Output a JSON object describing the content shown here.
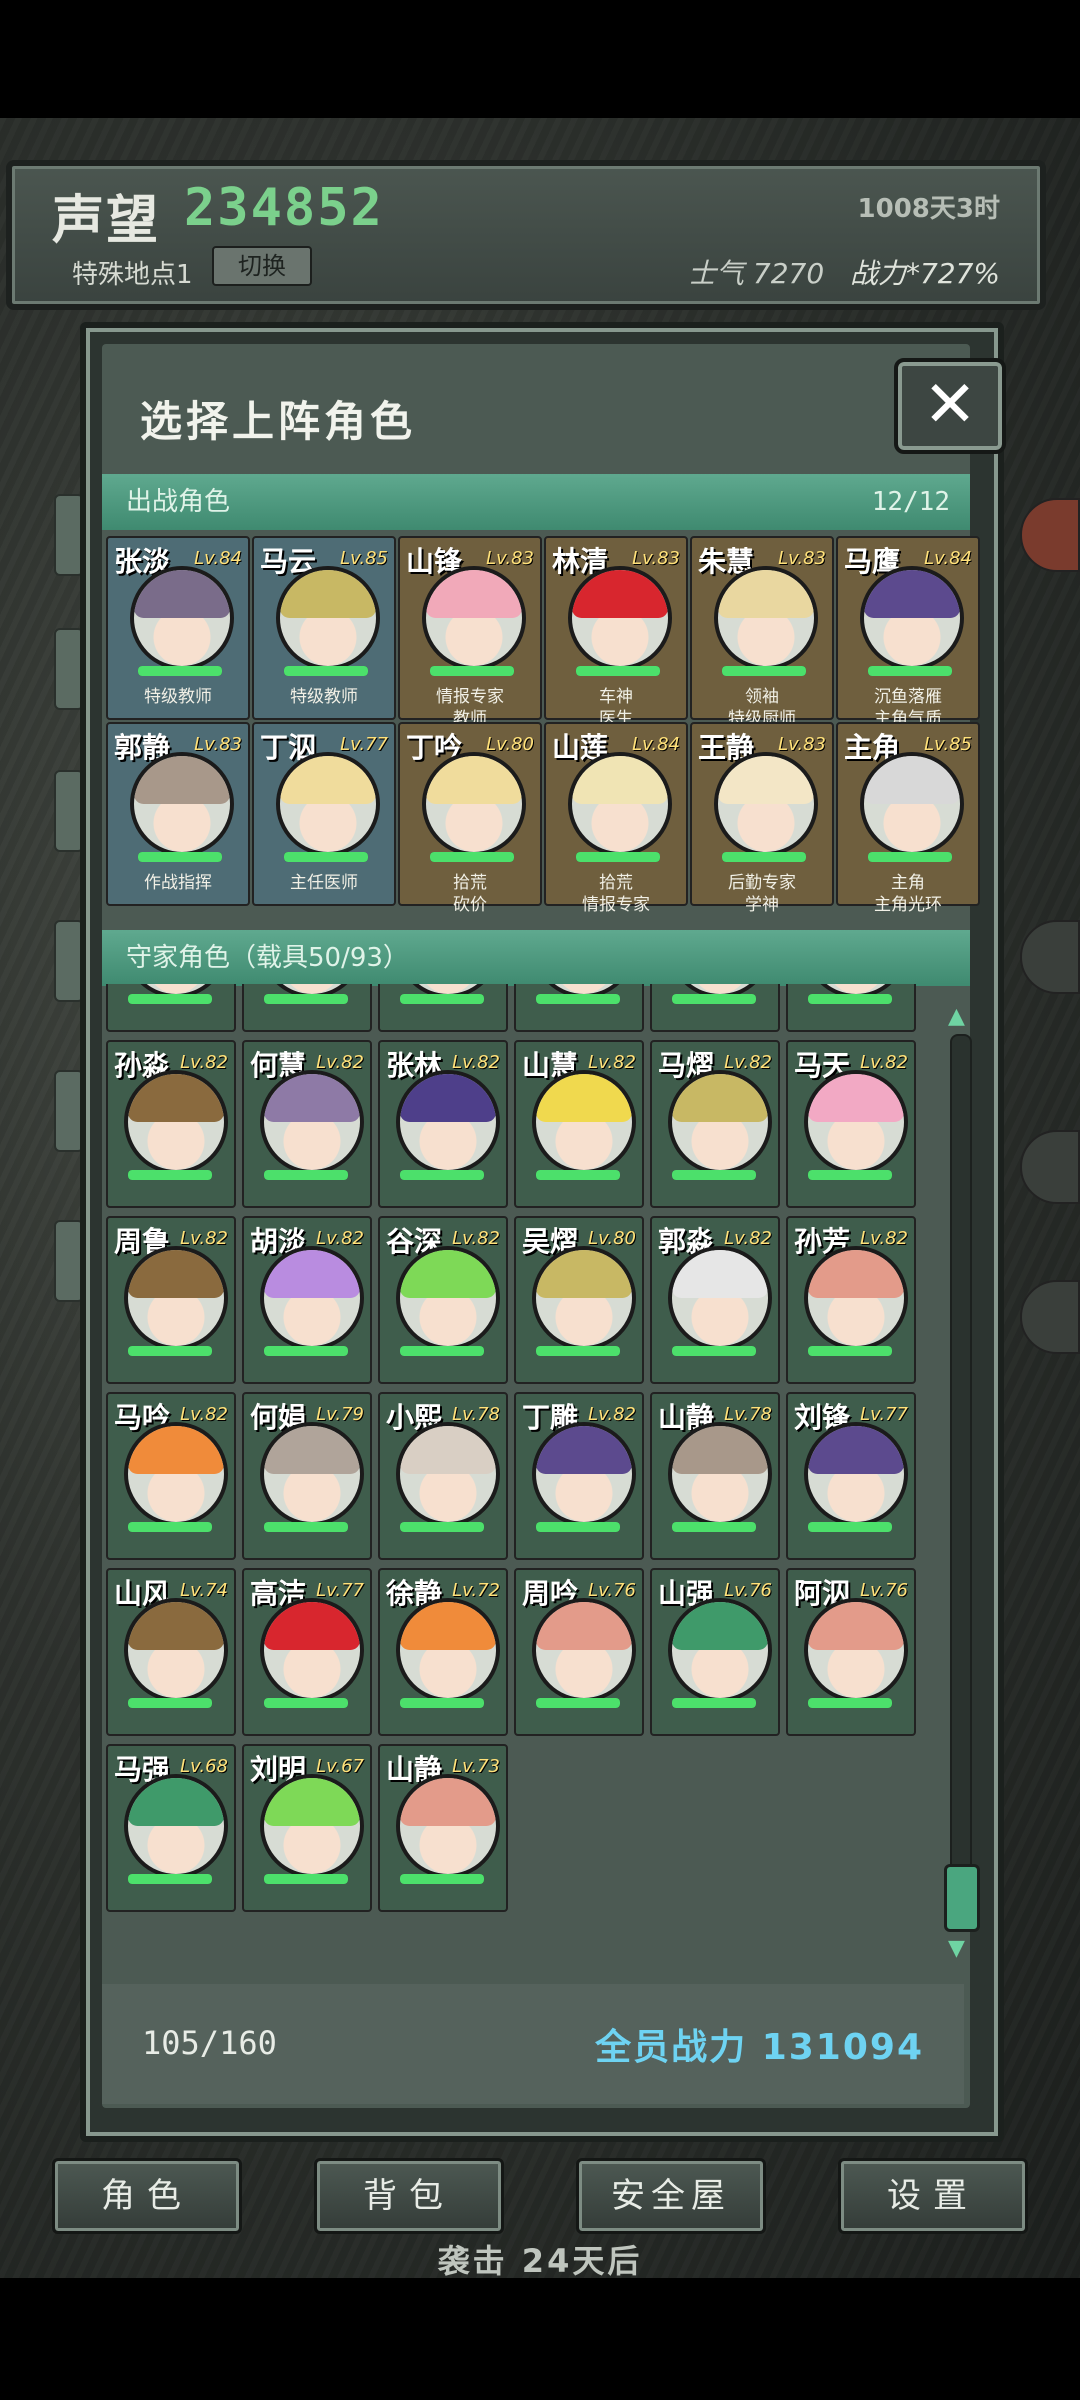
{
  "header": {
    "reputation_label": "声望",
    "reputation_value": "234852",
    "days": "1008天3时",
    "location_label": "特殊地点1",
    "switch_label": "切换",
    "morale": "士气 7270",
    "power": "战力*727%"
  },
  "modal": {
    "title": "选择上阵角色",
    "close_label": "✕",
    "deployed_header": "出战角色",
    "deployed_count": "12/12",
    "home_header": "守家角色（载具50/93）",
    "roster_count": "105/160",
    "total_power_label": "全员战力",
    "total_power_value": "131094"
  },
  "deployed": [
    {
      "name": "张淡",
      "level": "Lv.84",
      "role1": "特级教师",
      "role2": "",
      "tone": "blue",
      "hair": "#7a6c8a"
    },
    {
      "name": "马云",
      "level": "Lv.85",
      "role1": "特级教师",
      "role2": "",
      "tone": "blue",
      "hair": "#c8b864"
    },
    {
      "name": "山锋",
      "level": "Lv.83",
      "role1": "情报专家",
      "role2": "教师",
      "tone": "brown",
      "hair": "#f1a9b9"
    },
    {
      "name": "林清",
      "level": "Lv.83",
      "role1": "车神",
      "role2": "医生",
      "tone": "brown",
      "hair": "#d8262e"
    },
    {
      "name": "朱慧",
      "level": "Lv.83",
      "role1": "领袖",
      "role2": "特级厨师",
      "tone": "brown",
      "hair": "#e9d7a0"
    },
    {
      "name": "马鹰",
      "level": "Lv.84",
      "role1": "沉鱼落雁",
      "role2": "主角气质",
      "tone": "brown",
      "hair": "#5c4a8e"
    },
    {
      "name": "郭静",
      "level": "Lv.83",
      "role1": "作战指挥",
      "role2": "",
      "tone": "blue",
      "hair": "#a8988a"
    },
    {
      "name": "丁泅",
      "level": "Lv.77",
      "role1": "主任医师",
      "role2": "",
      "tone": "blue",
      "hair": "#f0dc9c"
    },
    {
      "name": "丁吟",
      "level": "Lv.80",
      "role1": "拾荒",
      "role2": "砍价",
      "tone": "brown",
      "hair": "#f0dc9c"
    },
    {
      "name": "山莲",
      "level": "Lv.84",
      "role1": "拾荒",
      "role2": "情报专家",
      "tone": "brown",
      "hair": "#f0e4b4"
    },
    {
      "name": "王静",
      "level": "Lv.83",
      "role1": "后勤专家",
      "role2": "学神",
      "tone": "brown",
      "hair": "#f3e6c6"
    },
    {
      "name": "主角",
      "level": "Lv.85",
      "role1": "主角",
      "role2": "主角光环",
      "tone": "brown",
      "hair": "#d8d8d8"
    }
  ],
  "home": [
    {
      "name": "",
      "level": "",
      "hair": "#6b5a4a"
    },
    {
      "name": "",
      "level": "",
      "hair": "#6b5a4a"
    },
    {
      "name": "",
      "level": "",
      "hair": "#6b5a4a"
    },
    {
      "name": "",
      "level": "",
      "hair": "#e8d6a4"
    },
    {
      "name": "",
      "level": "",
      "hair": "#e8d6a4"
    },
    {
      "name": "",
      "level": "",
      "hair": "#e8d6a4"
    },
    {
      "name": "孙淼",
      "level": "Lv.82",
      "hair": "#8a6a3e"
    },
    {
      "name": "何慧",
      "level": "Lv.82",
      "hair": "#8e7aa6"
    },
    {
      "name": "张林",
      "level": "Lv.82",
      "hair": "#4e3f8a"
    },
    {
      "name": "山慧",
      "level": "Lv.82",
      "hair": "#f0d94e"
    },
    {
      "name": "马熠",
      "level": "Lv.82",
      "hair": "#c8b864"
    },
    {
      "name": "马天",
      "level": "Lv.82",
      "hair": "#f2a9c4"
    },
    {
      "name": "周鲁",
      "level": "Lv.82",
      "hair": "#8a6a3e"
    },
    {
      "name": "胡淡",
      "level": "Lv.82",
      "hair": "#b98ce0"
    },
    {
      "name": "谷深",
      "level": "Lv.82",
      "hair": "#7ed957"
    },
    {
      "name": "吴熠",
      "level": "Lv.80",
      "hair": "#c8b864"
    },
    {
      "name": "郭淼",
      "level": "Lv.82",
      "hair": "#e6e6e6"
    },
    {
      "name": "孙芳",
      "level": "Lv.82",
      "hair": "#e39b8a"
    },
    {
      "name": "马吟",
      "level": "Lv.82",
      "hair": "#f08b3a"
    },
    {
      "name": "何娟",
      "level": "Lv.79",
      "hair": "#b0a49a"
    },
    {
      "name": "小熙",
      "level": "Lv.78",
      "hair": "#d9cfc4"
    },
    {
      "name": "丁雕",
      "level": "Lv.82",
      "hair": "#5c4a8e"
    },
    {
      "name": "山静",
      "level": "Lv.78",
      "hair": "#a8988a"
    },
    {
      "name": "刘锋",
      "level": "Lv.77",
      "hair": "#5c4a8e"
    },
    {
      "name": "山风",
      "level": "Lv.74",
      "hair": "#8a6a3e"
    },
    {
      "name": "高洁",
      "level": "Lv.77",
      "hair": "#d8262e"
    },
    {
      "name": "徐静",
      "level": "Lv.72",
      "hair": "#f08b3a"
    },
    {
      "name": "周吟",
      "level": "Lv.76",
      "hair": "#e39b8a"
    },
    {
      "name": "山强",
      "level": "Lv.76",
      "hair": "#3f9a6a"
    },
    {
      "name": "阿泅",
      "level": "Lv.76",
      "hair": "#e39b8a"
    },
    {
      "name": "马强",
      "level": "Lv.68",
      "hair": "#3f9a6a"
    },
    {
      "name": "刘明",
      "level": "Lv.67",
      "hair": "#7ed957"
    },
    {
      "name": "山静",
      "level": "Lv.73",
      "hair": "#e39b8a"
    }
  ],
  "nav": [
    {
      "label": "角色"
    },
    {
      "label": "背包"
    },
    {
      "label": "安全屋"
    },
    {
      "label": "设置"
    }
  ],
  "raid_text": "袭击 24天后",
  "side_marks": [
    "8",
    "5",
    "8",
    "4",
    "8",
    "8",
    "5",
    "8",
    "8",
    "5"
  ],
  "colors": {
    "accent": "#5fa98f",
    "power_text": "#6ed3f2",
    "reputation": "#7bd08c",
    "hp_bar": "#4ce06b"
  }
}
